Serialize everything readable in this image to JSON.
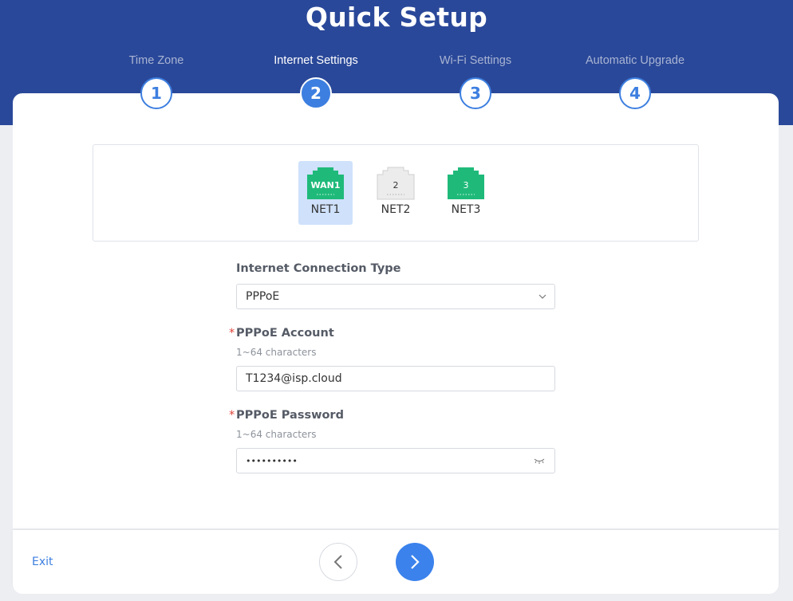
{
  "header": {
    "title": "Quick Setup"
  },
  "steps": [
    {
      "label": "Time Zone",
      "number": "1",
      "active": false
    },
    {
      "label": "Internet Settings",
      "number": "2",
      "active": true
    },
    {
      "label": "Wi-Fi Settings",
      "number": "3",
      "active": false
    },
    {
      "label": "Automatic Upgrade",
      "number": "4",
      "active": false
    }
  ],
  "ports": [
    {
      "icon_text": "WAN1",
      "label": "NET1",
      "selected": true,
      "color": "#1fba7a"
    },
    {
      "icon_text": "2",
      "label": "NET2",
      "selected": false,
      "color": "#ececec"
    },
    {
      "icon_text": "3",
      "label": "NET3",
      "selected": false,
      "color": "#1fba7a"
    }
  ],
  "form": {
    "connection_type": {
      "label": "Internet Connection Type",
      "value": "PPPoE"
    },
    "account": {
      "required_mark": "*",
      "label": "PPPoE Account",
      "hint": "1~64 characters",
      "value": "T1234@isp.cloud"
    },
    "password": {
      "required_mark": "*",
      "label": "PPPoE Password",
      "hint": "1~64 characters",
      "value": "••••••••••"
    }
  },
  "footer": {
    "exit_label": "Exit"
  },
  "colors": {
    "banner": "#2a4899",
    "accent": "#3d7fe0",
    "port_green": "#1fba7a",
    "required": "#e0443a"
  },
  "icons": {
    "select": "chevron-down-icon",
    "password": "eye-closed-icon",
    "prev": "chevron-left-icon",
    "next": "chevron-right-icon"
  }
}
